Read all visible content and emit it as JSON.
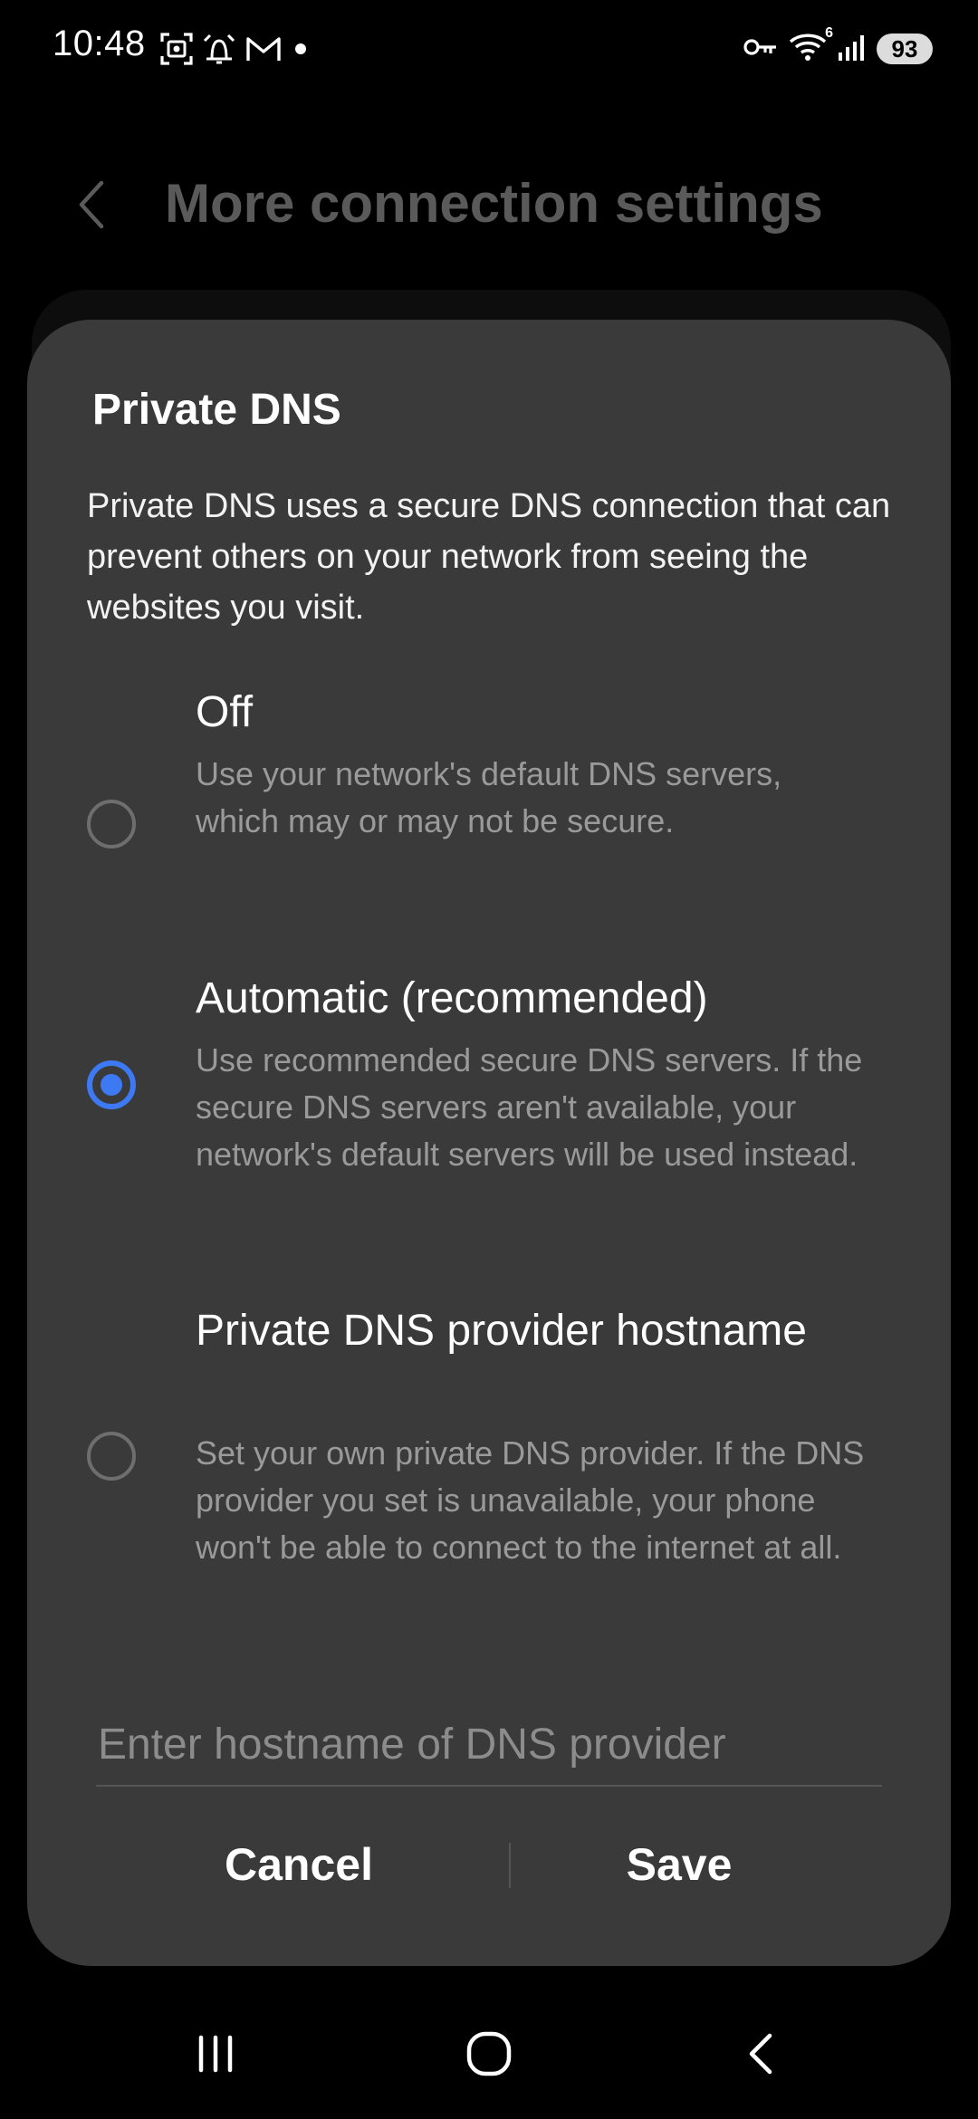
{
  "status_bar": {
    "time": "10:48",
    "battery": "93",
    "wifi_badge": "6",
    "left_icons": [
      "screenshot-icon",
      "alarm-icon",
      "gmail-icon",
      "notification-dot"
    ],
    "right_icons": [
      "vpn-key-icon",
      "wifi-icon",
      "signal-icon",
      "battery-icon"
    ]
  },
  "header": {
    "title": "More connection settings",
    "back_icon": "chevron-left-icon"
  },
  "dialog": {
    "title": "Private DNS",
    "description": "Private DNS uses a secure DNS connection that can prevent others on your network from seeing the websites you visit.",
    "options": [
      {
        "title": "Off",
        "description": "Use your network's default DNS servers, which may or may not be secure.",
        "selected": false
      },
      {
        "title": "Automatic (recommended)",
        "description": "Use recommended secure DNS servers. If the secure DNS servers aren't available, your network's default servers will be used instead.",
        "selected": true
      },
      {
        "title": "Private DNS provider hostname",
        "description": "Set your own private DNS provider. If the DNS provider you set is unavailable, your phone won't be able to connect to the internet at all.",
        "selected": false
      }
    ],
    "hostname_input": {
      "value": "",
      "placeholder": "Enter hostname of DNS provider"
    },
    "cancel_label": "Cancel",
    "save_label": "Save"
  },
  "nav_bar": {
    "icons": [
      "recent-apps-icon",
      "home-icon",
      "back-icon"
    ]
  },
  "colors": {
    "background": "#000000",
    "dialog": "#3a3a3a",
    "accent": "#3d79f2",
    "secondary_text": "#9a9a9a"
  }
}
